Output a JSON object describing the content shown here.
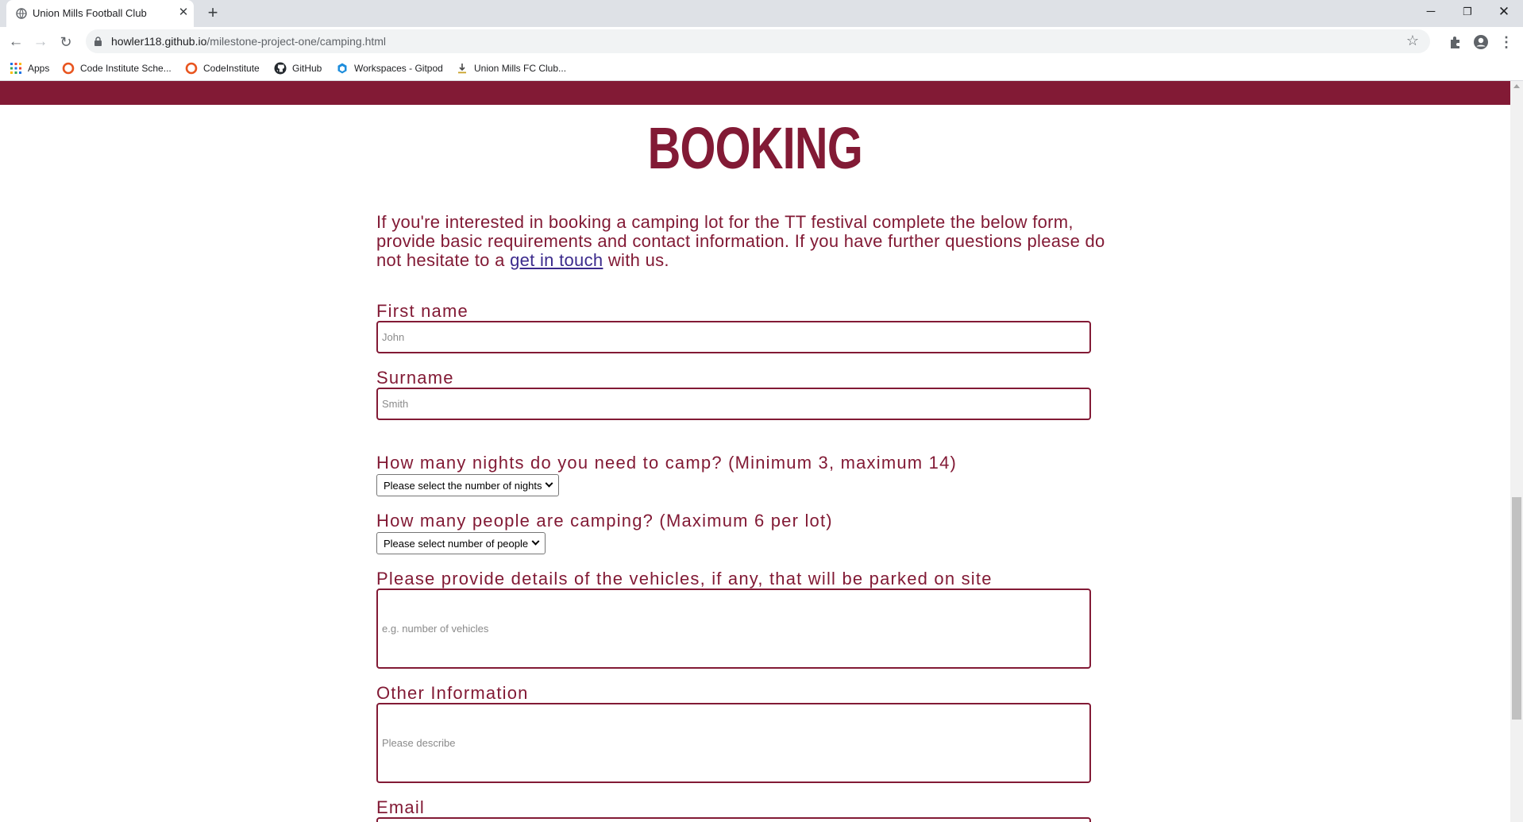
{
  "browser": {
    "tab_title": "Union Mills Football Club",
    "url_host": "howler118.github.io",
    "url_path": "/milestone-project-one/camping.html",
    "bookmarks": [
      {
        "label": "Apps",
        "icon": "apps-grid-icon"
      },
      {
        "label": "Code Institute Sche...",
        "icon": "code-institute-icon"
      },
      {
        "label": "CodeInstitute",
        "icon": "code-institute-icon"
      },
      {
        "label": "GitHub",
        "icon": "github-icon"
      },
      {
        "label": "Workspaces - Gitpod",
        "icon": "gitpod-icon"
      },
      {
        "label": "Union Mills FC Club...",
        "icon": "download-icon"
      }
    ]
  },
  "colors": {
    "brand": "#821a35",
    "link": "#3b2a8c"
  },
  "page": {
    "heading": "BOOKING",
    "intro_before": "If you're interested in booking a camping lot for the TT festival complete the below form, provide basic requirements and contact information. If you have further questions please do not hesitate to a ",
    "intro_link": "get in touch",
    "intro_after": " with us."
  },
  "form": {
    "first_name_label": "First name",
    "first_name_placeholder": "John",
    "surname_label": "Surname",
    "surname_placeholder": "Smith",
    "nights_label": "How many nights do you need to camp? (Minimum 3, maximum 14)",
    "nights_selected": "Please select the number of nights",
    "people_label": "How many people are camping? (Maximum 6 per lot)",
    "people_selected": "Please select number of people",
    "vehicles_label": "Please provide details of the vehicles, if any, that will be parked on site",
    "vehicles_placeholder": "e.g. number of vehicles",
    "other_label": "Other Information",
    "other_placeholder": "Please describe",
    "email_label": "Email"
  }
}
